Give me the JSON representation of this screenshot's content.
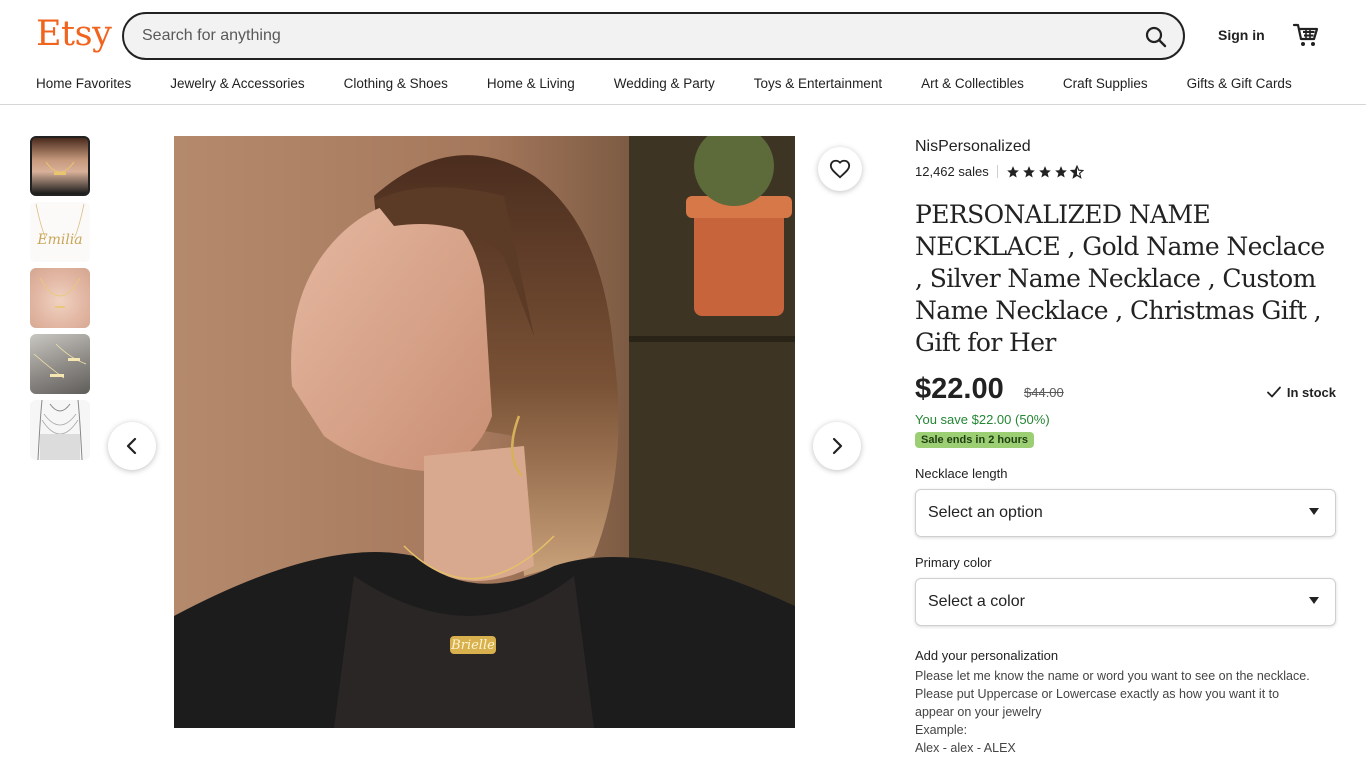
{
  "header": {
    "logo": "Etsy",
    "search_placeholder": "Search for anything",
    "signin_label": "Sign in"
  },
  "nav": [
    "Home Favorites",
    "Jewelry & Accessories",
    "Clothing & Shoes",
    "Home & Living",
    "Wedding & Party",
    "Toys & Entertainment",
    "Art & Collectibles",
    "Craft Supplies",
    "Gifts & Gift Cards"
  ],
  "listing": {
    "shop_name": "NisPersonalized",
    "sales": "12,462 sales",
    "rating": 4.5,
    "title": "PERSONALIZED NAME NECKLACE , Gold Name Neclace , Silver Name Necklace , Custom Name Necklace , Christmas Gift , Gift for Her",
    "price": "$22.00",
    "original_price": "$44.00",
    "stock": "In stock",
    "savings": "You save $22.00 (50%)",
    "sale_badge": "Sale ends in 2 hours",
    "necklace_length_label": "Necklace length",
    "necklace_length_value": "Select an option",
    "color_label": "Primary color",
    "color_value": "Select a color",
    "personalization_label": "Add your personalization",
    "personalization_lines": [
      "Please let me know the name or word you want to see on the necklace.",
      "Please put Uppercase or Lowercase exactly as how you want it to appear on your jewelry",
      "Example:",
      "Alex - alex - ALEX"
    ]
  },
  "gallery": {
    "thumb_text_2": "Emilia",
    "necklace_name": "Brielle"
  },
  "colors": {
    "brand": "#f1641e",
    "sale_green": "#258635",
    "badge_green": "#9ccf74"
  }
}
